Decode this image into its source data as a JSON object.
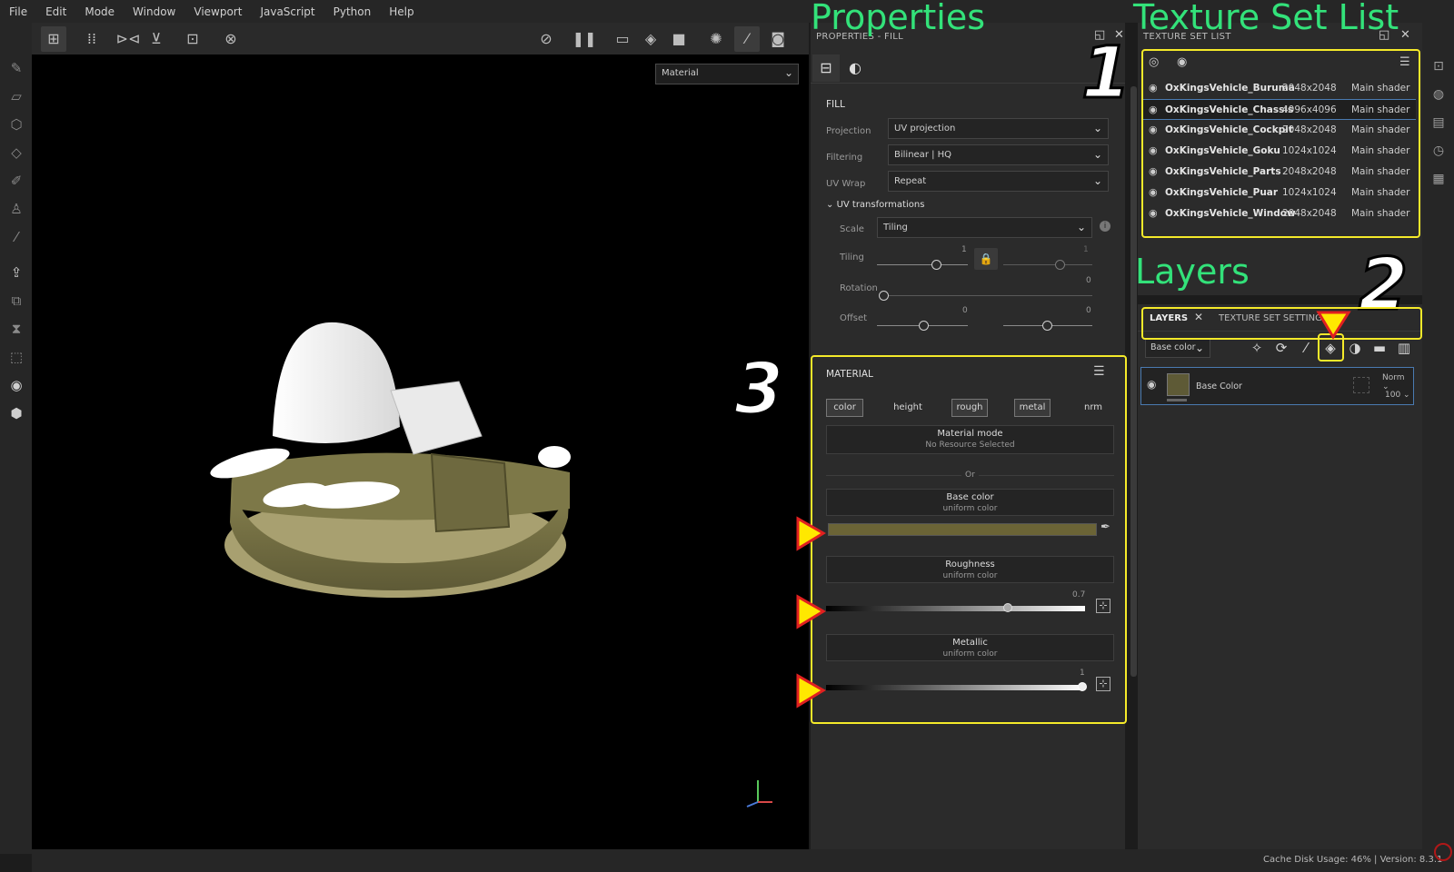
{
  "menu": [
    "File",
    "Edit",
    "Mode",
    "Window",
    "Viewport",
    "JavaScript",
    "Python",
    "Help"
  ],
  "viewport": {
    "mode_select": "Material"
  },
  "properties": {
    "panel_title": "PROPERTIES - FILL",
    "fill_header": "FILL",
    "projection_label": "Projection",
    "projection_value": "UV projection",
    "filtering_label": "Filtering",
    "filtering_value": "Bilinear | HQ",
    "uvwrap_label": "UV Wrap",
    "uvwrap_value": "Repeat",
    "uv_transform_header": "UV transformations",
    "scale_label": "Scale",
    "scale_value": "Tiling",
    "tiling_label": "Tiling",
    "tiling_value_1": "1",
    "tiling_value_2": "1",
    "rotation_label": "Rotation",
    "rotation_value": "0",
    "offset_label": "Offset",
    "offset_value_1": "0",
    "offset_value_2": "0",
    "material": {
      "header": "MATERIAL",
      "tabs": [
        "color",
        "height",
        "rough",
        "metal",
        "nrm"
      ],
      "material_mode_title": "Material mode",
      "material_mode_sub": "No Resource Selected",
      "or": "Or",
      "base_color_title": "Base color",
      "base_color_sub": "uniform color",
      "base_color_swatch": "#6b6436",
      "roughness_title": "Roughness",
      "roughness_sub": "uniform color",
      "roughness_value": "0.7",
      "metallic_title": "Metallic",
      "metallic_sub": "uniform color",
      "metallic_value": "1"
    }
  },
  "texture_set_list": {
    "panel_title": "TEXTURE SET LIST",
    "rows": [
      {
        "name": "OxKingsVehicle_Buruma",
        "res": "2048x2048",
        "shader": "Main shader"
      },
      {
        "name": "OxKingsVehicle_Chassis",
        "res": "4096x4096",
        "shader": "Main shader"
      },
      {
        "name": "OxKingsVehicle_Cockpit",
        "res": "2048x2048",
        "shader": "Main shader"
      },
      {
        "name": "OxKingsVehicle_Goku",
        "res": "1024x1024",
        "shader": "Main shader"
      },
      {
        "name": "OxKingsVehicle_Parts",
        "res": "2048x2048",
        "shader": "Main shader"
      },
      {
        "name": "OxKingsVehicle_Puar",
        "res": "1024x1024",
        "shader": "Main shader"
      },
      {
        "name": "OxKingsVehicle_Window",
        "res": "2048x2048",
        "shader": "Main shader"
      }
    ]
  },
  "layers": {
    "tab_layers": "LAYERS",
    "tab_texture_set_settings": "TEXTURE SET SETTING",
    "channel_select": "Base color",
    "layer_name": "Base Color",
    "blend_mode": "Norm",
    "opacity": "100",
    "layer_thumb_color": "#5e5a36"
  },
  "status": {
    "text": "Cache Disk Usage:   46%  |  Version: 8.3.1"
  },
  "annotations": {
    "properties_title": "Properties",
    "texture_set_list_title": "Texture Set List",
    "layers_title": "Layers",
    "num_1": "1",
    "num_2": "2",
    "num_3": "3"
  },
  "colors": {
    "highlight": "#f5ea2a",
    "annotation_green": "#33e27a",
    "arrow_red": "#e02020",
    "arrow_yellow": "#ffe800"
  }
}
